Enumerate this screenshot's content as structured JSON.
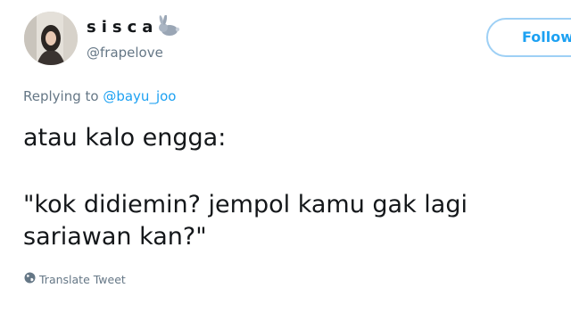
{
  "user": {
    "display_name": "sisca",
    "name_emoji": "rabbit-emoji",
    "handle": "@frapelove",
    "avatar": "profile-avatar"
  },
  "follow_button": {
    "label": "Follow"
  },
  "reply_context": {
    "prefix": "Replying to ",
    "mention": "@bayu_joo"
  },
  "tweet": {
    "lines": [
      "atau kalo engga:",
      "\"kok didiemin? jempol kamu gak lagi",
      "sariawan kan?\""
    ]
  },
  "translate": {
    "icon": "globe-icon",
    "label": "Translate Tweet"
  },
  "colors": {
    "accent": "#1da1f2",
    "secondary_text": "#657786",
    "primary_text": "#14171a"
  }
}
